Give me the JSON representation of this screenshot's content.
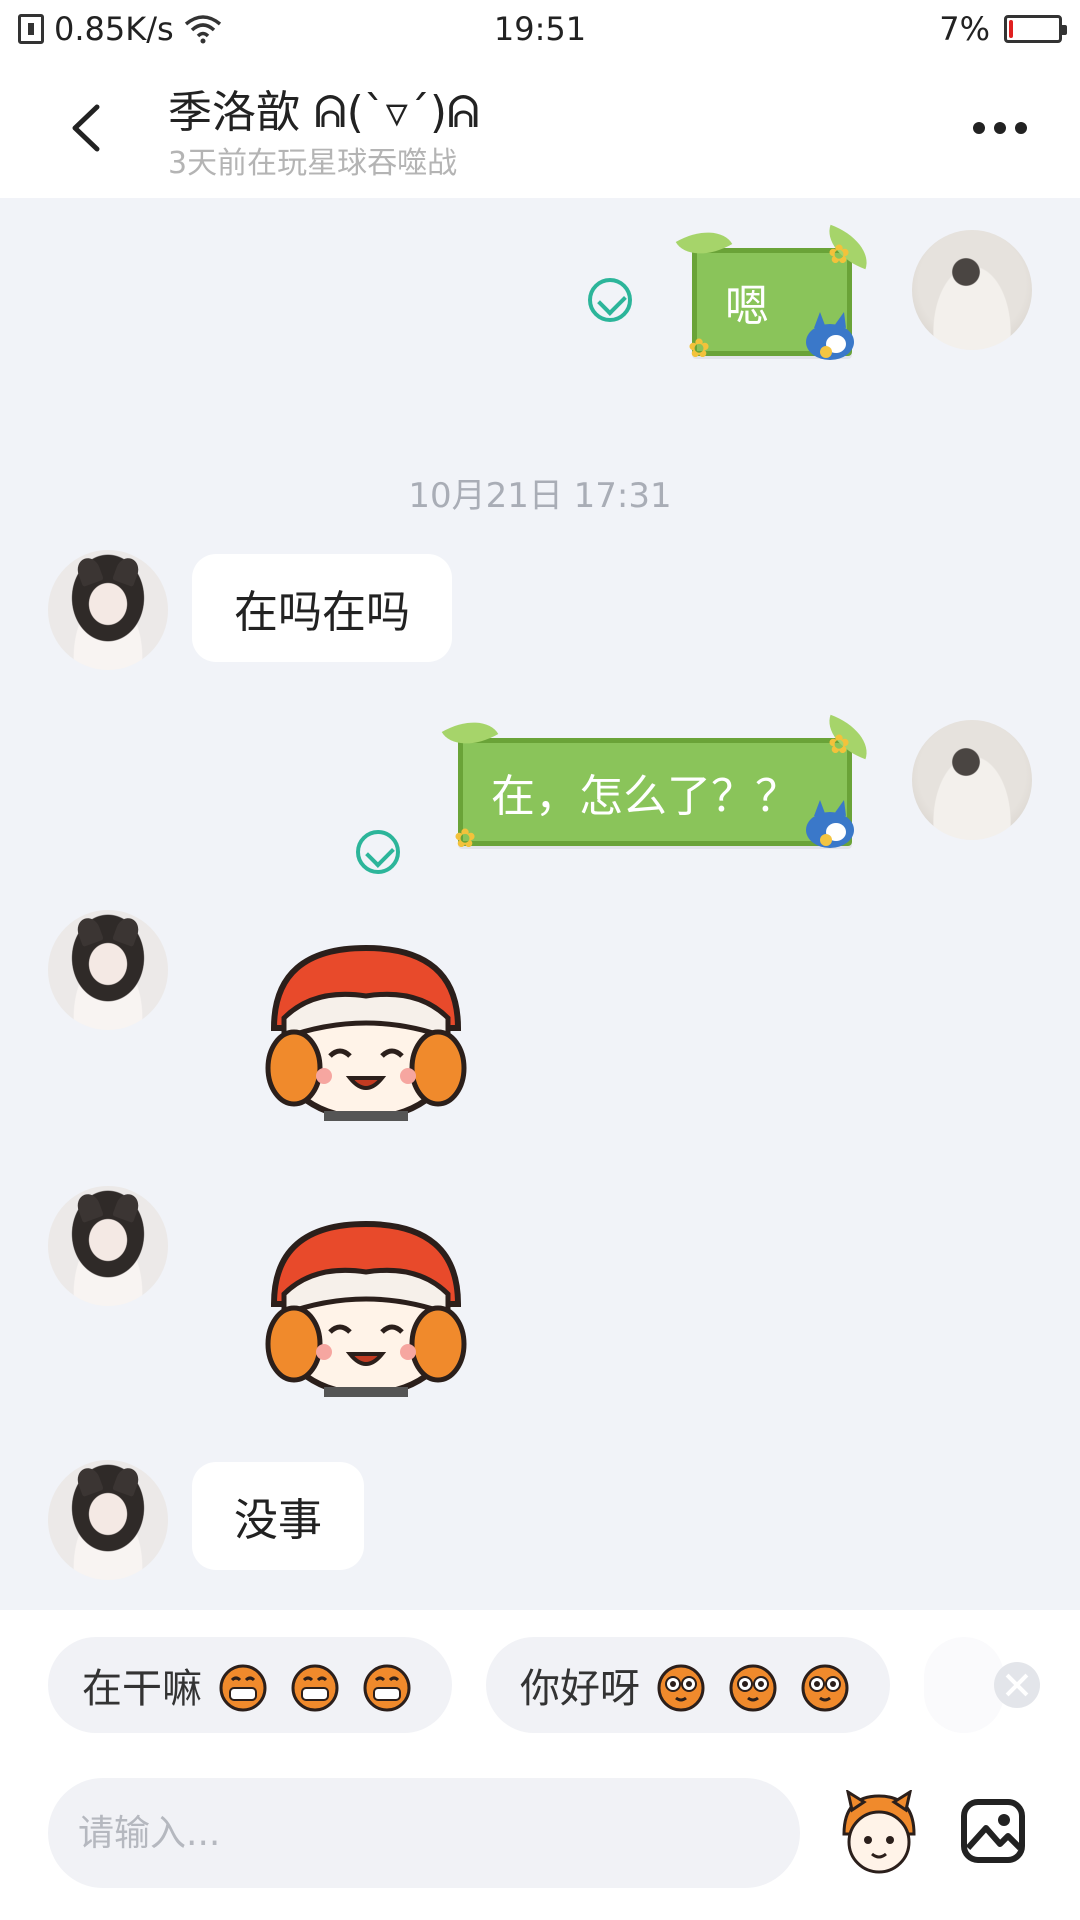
{
  "status_bar": {
    "network_speed": "0.85K/s",
    "time": "19:51",
    "battery_percent": "7%",
    "battery_level": 0.07
  },
  "header": {
    "title": "季洛歆 ᕱ(`▿´)ᕱ",
    "subtitle": "3天前在玩星球吞噬战"
  },
  "messages": {
    "m1_text": "嗯",
    "timestamp": "10月21日 17:31",
    "m2_text": "在吗在吗",
    "m3_text": "在，怎么了？？",
    "m6_text": "没事"
  },
  "quick_replies": [
    {
      "label": "在干嘛"
    },
    {
      "label": "你好呀"
    }
  ],
  "input": {
    "placeholder": "请输入..."
  },
  "colors": {
    "bubble_green": "#8ac45a",
    "read_check": "#2cb59a",
    "battery_low": "#e02020"
  }
}
